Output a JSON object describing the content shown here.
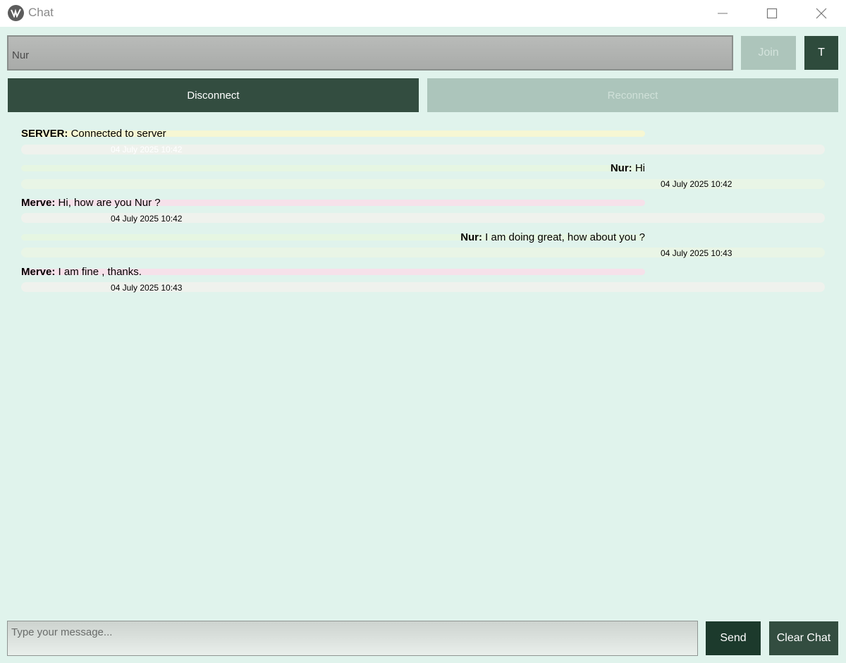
{
  "window": {
    "title": "Chat",
    "icon": "app-logo-icon"
  },
  "top_bar": {
    "username_value": "Nur",
    "join_label": "Join",
    "t_label": "T",
    "disconnect_label": "Disconnect",
    "reconnect_label": "Reconnect"
  },
  "messages": [
    {
      "sender": "SERVER:",
      "text": " Connected to server",
      "time": "04 July 2025 10:42",
      "align": "left"
    },
    {
      "sender": "Nur:",
      "text": " Hi",
      "time": "04 July 2025 10:42",
      "align": "right"
    },
    {
      "sender": "Merve:",
      "text": " Hi, how are you Nur ?",
      "time": "04 July 2025 10:42",
      "align": "left"
    },
    {
      "sender": "Nur:",
      "text": " I am doing great, how about you ?",
      "time": "04 July 2025 10:43",
      "align": "right"
    },
    {
      "sender": "Merve:",
      "text": " I am fine , thanks.",
      "time": "04 July 2025 10:43",
      "align": "left"
    }
  ],
  "bottom_bar": {
    "message_placeholder": "Type your message...",
    "send_label": "Send",
    "clear_label": "Clear Chat"
  },
  "colors": {
    "background": "#e0f3ec",
    "dark_green": "#334d40",
    "disabled_green": "#adc5bb",
    "server_bubble": "#f6f7d3",
    "own_bubble": "#e6f6e2",
    "other_bubble": "#f6e1ea",
    "timestamp_bar": "#eff3ee"
  }
}
